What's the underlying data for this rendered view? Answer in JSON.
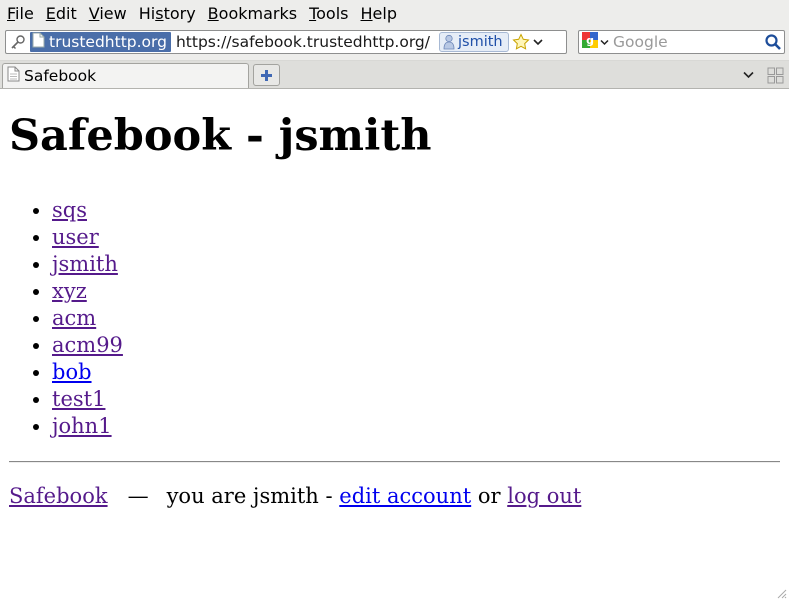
{
  "menu": {
    "items": [
      {
        "underline": "F",
        "rest": "ile"
      },
      {
        "underline": "E",
        "rest": "dit"
      },
      {
        "underline": "V",
        "rest": "iew"
      },
      {
        "pre": "Hi",
        "underline": "s",
        "rest": "tory"
      },
      {
        "underline": "B",
        "rest": "ookmarks"
      },
      {
        "underline": "T",
        "rest": "ools"
      },
      {
        "underline": "H",
        "rest": "elp"
      }
    ]
  },
  "navbar": {
    "identity_label": "trustedhttp.org",
    "url": "https://safebook.trustedhttp.org/",
    "user_badge": "jsmith",
    "search_placeholder": "Google"
  },
  "tabs": {
    "active_label": "Safebook"
  },
  "page": {
    "title": "Safebook - jsmith",
    "users": [
      {
        "name": "sqs",
        "visited": true
      },
      {
        "name": "user",
        "visited": true
      },
      {
        "name": "jsmith",
        "visited": true
      },
      {
        "name": "xyz",
        "visited": true
      },
      {
        "name": "acm",
        "visited": true
      },
      {
        "name": "acm99",
        "visited": true
      },
      {
        "name": "bob",
        "visited": false
      },
      {
        "name": "test1",
        "visited": true
      },
      {
        "name": "john1",
        "visited": true
      }
    ],
    "footer": {
      "home_link": "Safebook",
      "dash": "—",
      "you_are": "you are jsmith -",
      "edit_link": "edit account",
      "or": "or",
      "logout_link": "log out"
    }
  },
  "colors": {
    "visited_link": "#551a8b",
    "unvisited_link": "#0000ee",
    "identity_bg": "#4a6ea9"
  }
}
